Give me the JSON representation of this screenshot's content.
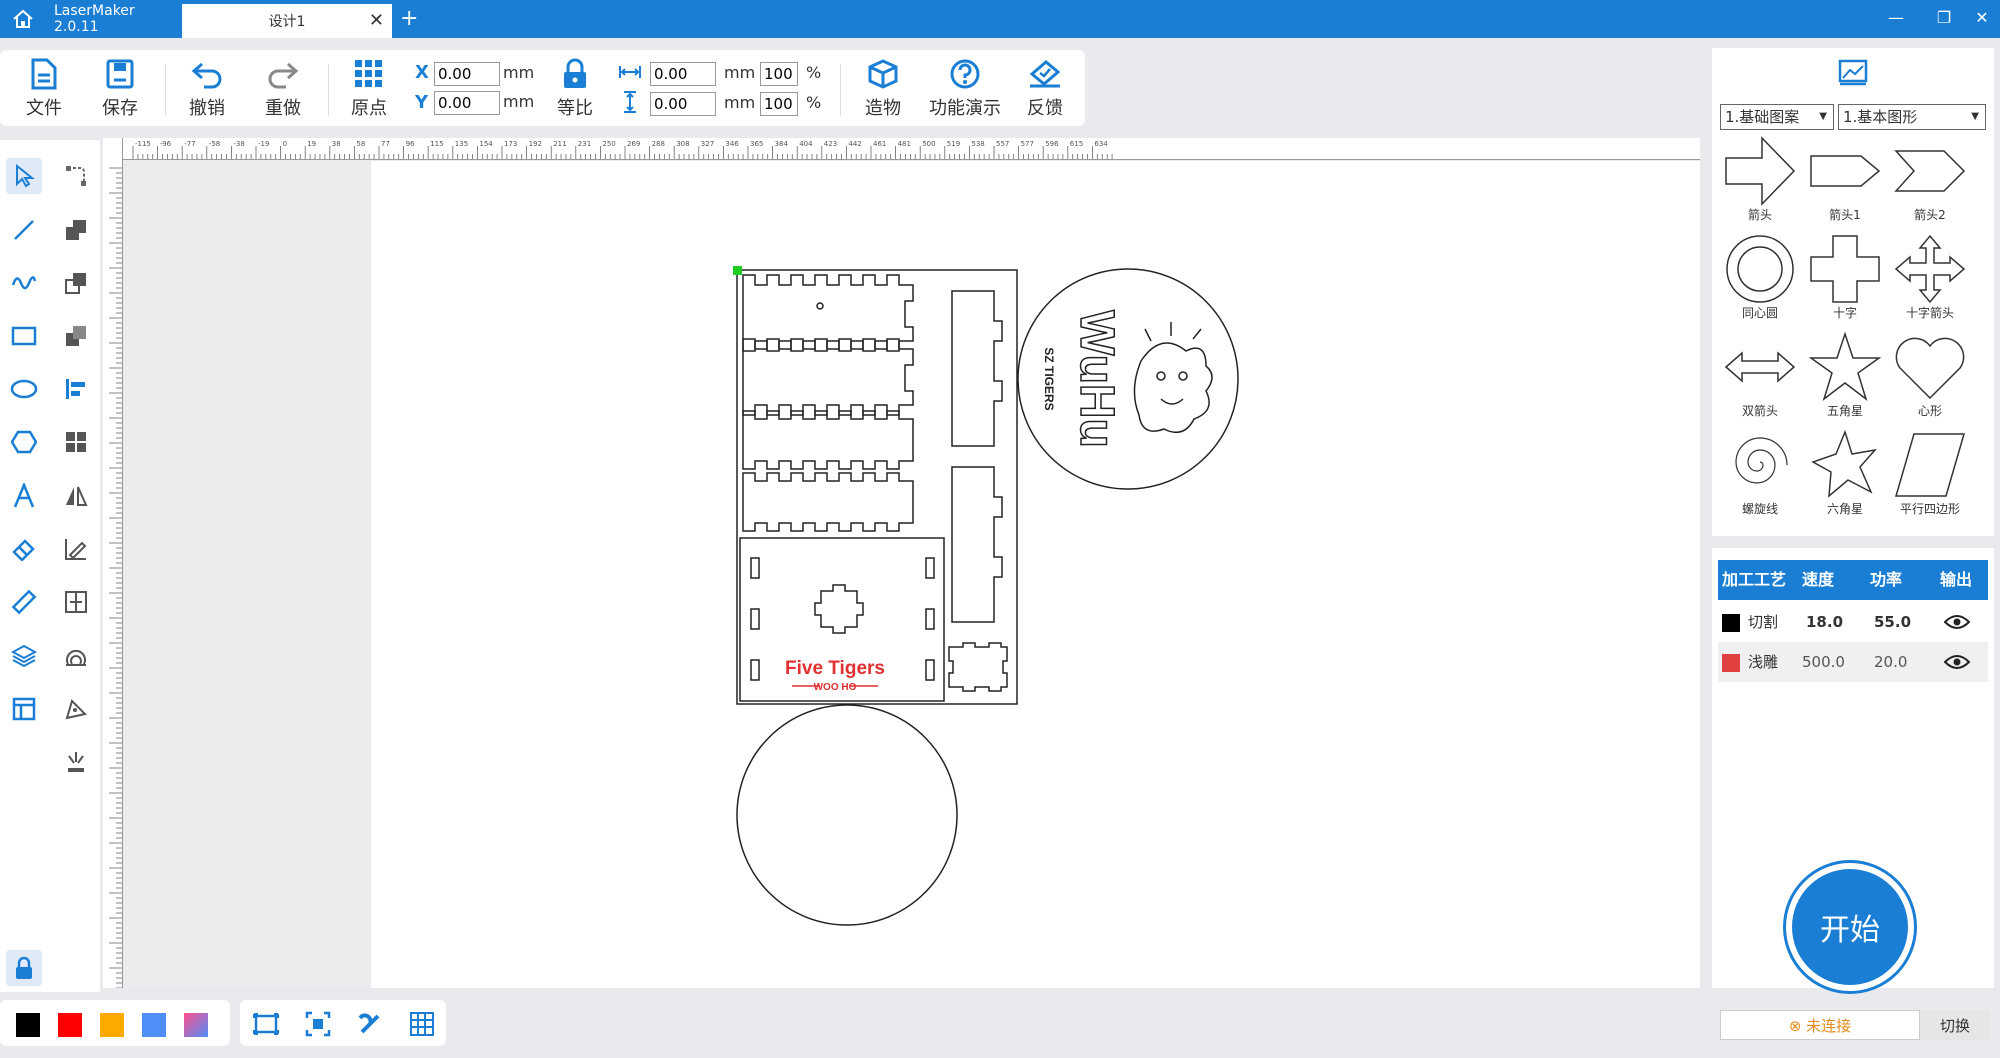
{
  "window": {
    "app_title": "LaserMaker 2.0.11",
    "doc_tab": "设计1",
    "new_tab": "+",
    "close": "✕",
    "minimize": "—",
    "restore": "❐",
    "close_window": "✕"
  },
  "toolbar": {
    "file": "文件",
    "save": "保存",
    "undo": "撤销",
    "redo": "重做",
    "origin": "原点",
    "x_label": "X",
    "y_label": "Y",
    "x_value": "0.00",
    "y_value": "0.00",
    "unit": "mm",
    "lock_ratio": "等比",
    "width_value": "0.00",
    "height_value": "0.00",
    "width_pct": "100",
    "height_pct": "100",
    "pct": "%",
    "build": "造物",
    "demo": "功能演示",
    "feedback": "反馈"
  },
  "ruler": {
    "h_ticks": [
      "-115",
      "-96",
      "-77",
      "-58",
      "-38",
      "-19",
      "0",
      "19",
      "38",
      "58",
      "77",
      "96",
      "115",
      "135",
      "154",
      "173",
      "192",
      "211",
      "231",
      "250",
      "269",
      "288",
      "308",
      "327",
      "346",
      "365",
      "384",
      "404",
      "423",
      "442",
      "461",
      "481",
      "500",
      "519",
      "538",
      "557",
      "577",
      "596",
      "615",
      "634"
    ],
    "unit": "mm"
  },
  "shapes_panel": {
    "category": "1.基础图案",
    "subcategory": "1.基本图形",
    "items": [
      "箭头",
      "箭头1",
      "箭头2",
      "同心圆",
      "十字",
      "十字箭头",
      "双箭头",
      "五角星",
      "心形",
      "螺旋线",
      "六角星",
      "平行四边形"
    ]
  },
  "process_table": {
    "headers": [
      "加工工艺",
      "速度",
      "功率",
      "输出"
    ],
    "rows": [
      {
        "color": "#000000",
        "name": "切割",
        "speed": "18.0",
        "power": "55.0"
      },
      {
        "color": "#e04040",
        "name": "浅雕",
        "speed": "500.0",
        "power": "20.0"
      }
    ]
  },
  "start": "开始",
  "connection": {
    "status": "⊗ 未连接",
    "switch": "切换"
  },
  "palette": [
    "#000000",
    "#ff0000",
    "#ffaa00",
    "#4f8ef7",
    "gradient"
  ],
  "design": {
    "label_main": "Five Tigers",
    "label_sub": "WOO HO",
    "disc_text": "WuHu",
    "disc_small": "SZ TIGERS"
  }
}
